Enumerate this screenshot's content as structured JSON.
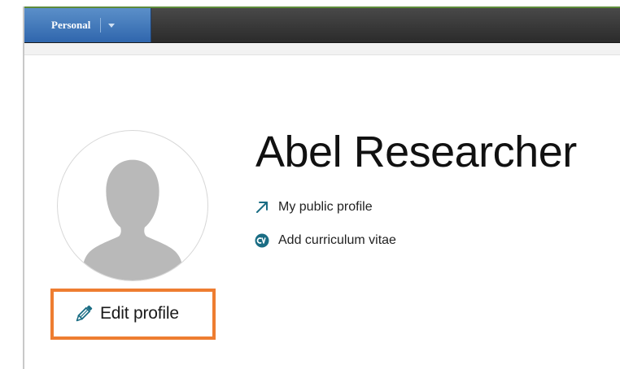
{
  "topbar": {
    "context_label": "Personal",
    "context_icon": "chevron-down-icon"
  },
  "profile": {
    "name": "Abel Researcher",
    "avatar_icon": "user-silhouette-icon",
    "edit_label": "Edit profile",
    "edit_icon": "pencil-icon",
    "highlight_color": "#ee7d31"
  },
  "links": {
    "public_profile": {
      "label": "My public profile",
      "icon": "external-arrow-icon"
    },
    "cv": {
      "label": "Add curriculum vitae",
      "icon": "cv-icon"
    }
  },
  "colors": {
    "accent_blue": "#2f66ad",
    "topbar_dark": "#333333",
    "icon_teal": "#1a6d84"
  }
}
